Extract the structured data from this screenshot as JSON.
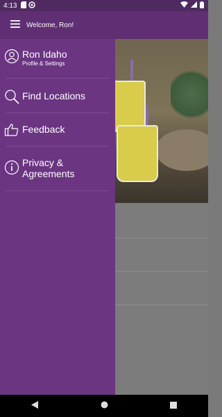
{
  "status_bar": {
    "time": "4:13",
    "icons": [
      "sd-card-icon",
      "sync-icon",
      "wifi-icon",
      "signal-icon",
      "battery-icon"
    ]
  },
  "app_bar": {
    "menu_icon": "hamburger-menu-icon",
    "welcome_text": "Welcome, Ron!"
  },
  "drawer": {
    "items": [
      {
        "icon": "user-profile-icon",
        "title": "Ron Idaho",
        "subtitle": "Profile & Settings"
      },
      {
        "icon": "search-icon",
        "title": "Find Locations"
      },
      {
        "icon": "thumbs-up-icon",
        "title": "Feedback"
      },
      {
        "icon": "info-icon",
        "title": "Privacy & Agreements"
      }
    ]
  },
  "nav_bar": {
    "buttons": [
      "back-icon",
      "home-icon",
      "recents-icon"
    ]
  },
  "colors": {
    "status_bar": "#4f2a60",
    "app_bar": "#5f2e73",
    "drawer": "#6b3582",
    "text": "#ffffff"
  }
}
